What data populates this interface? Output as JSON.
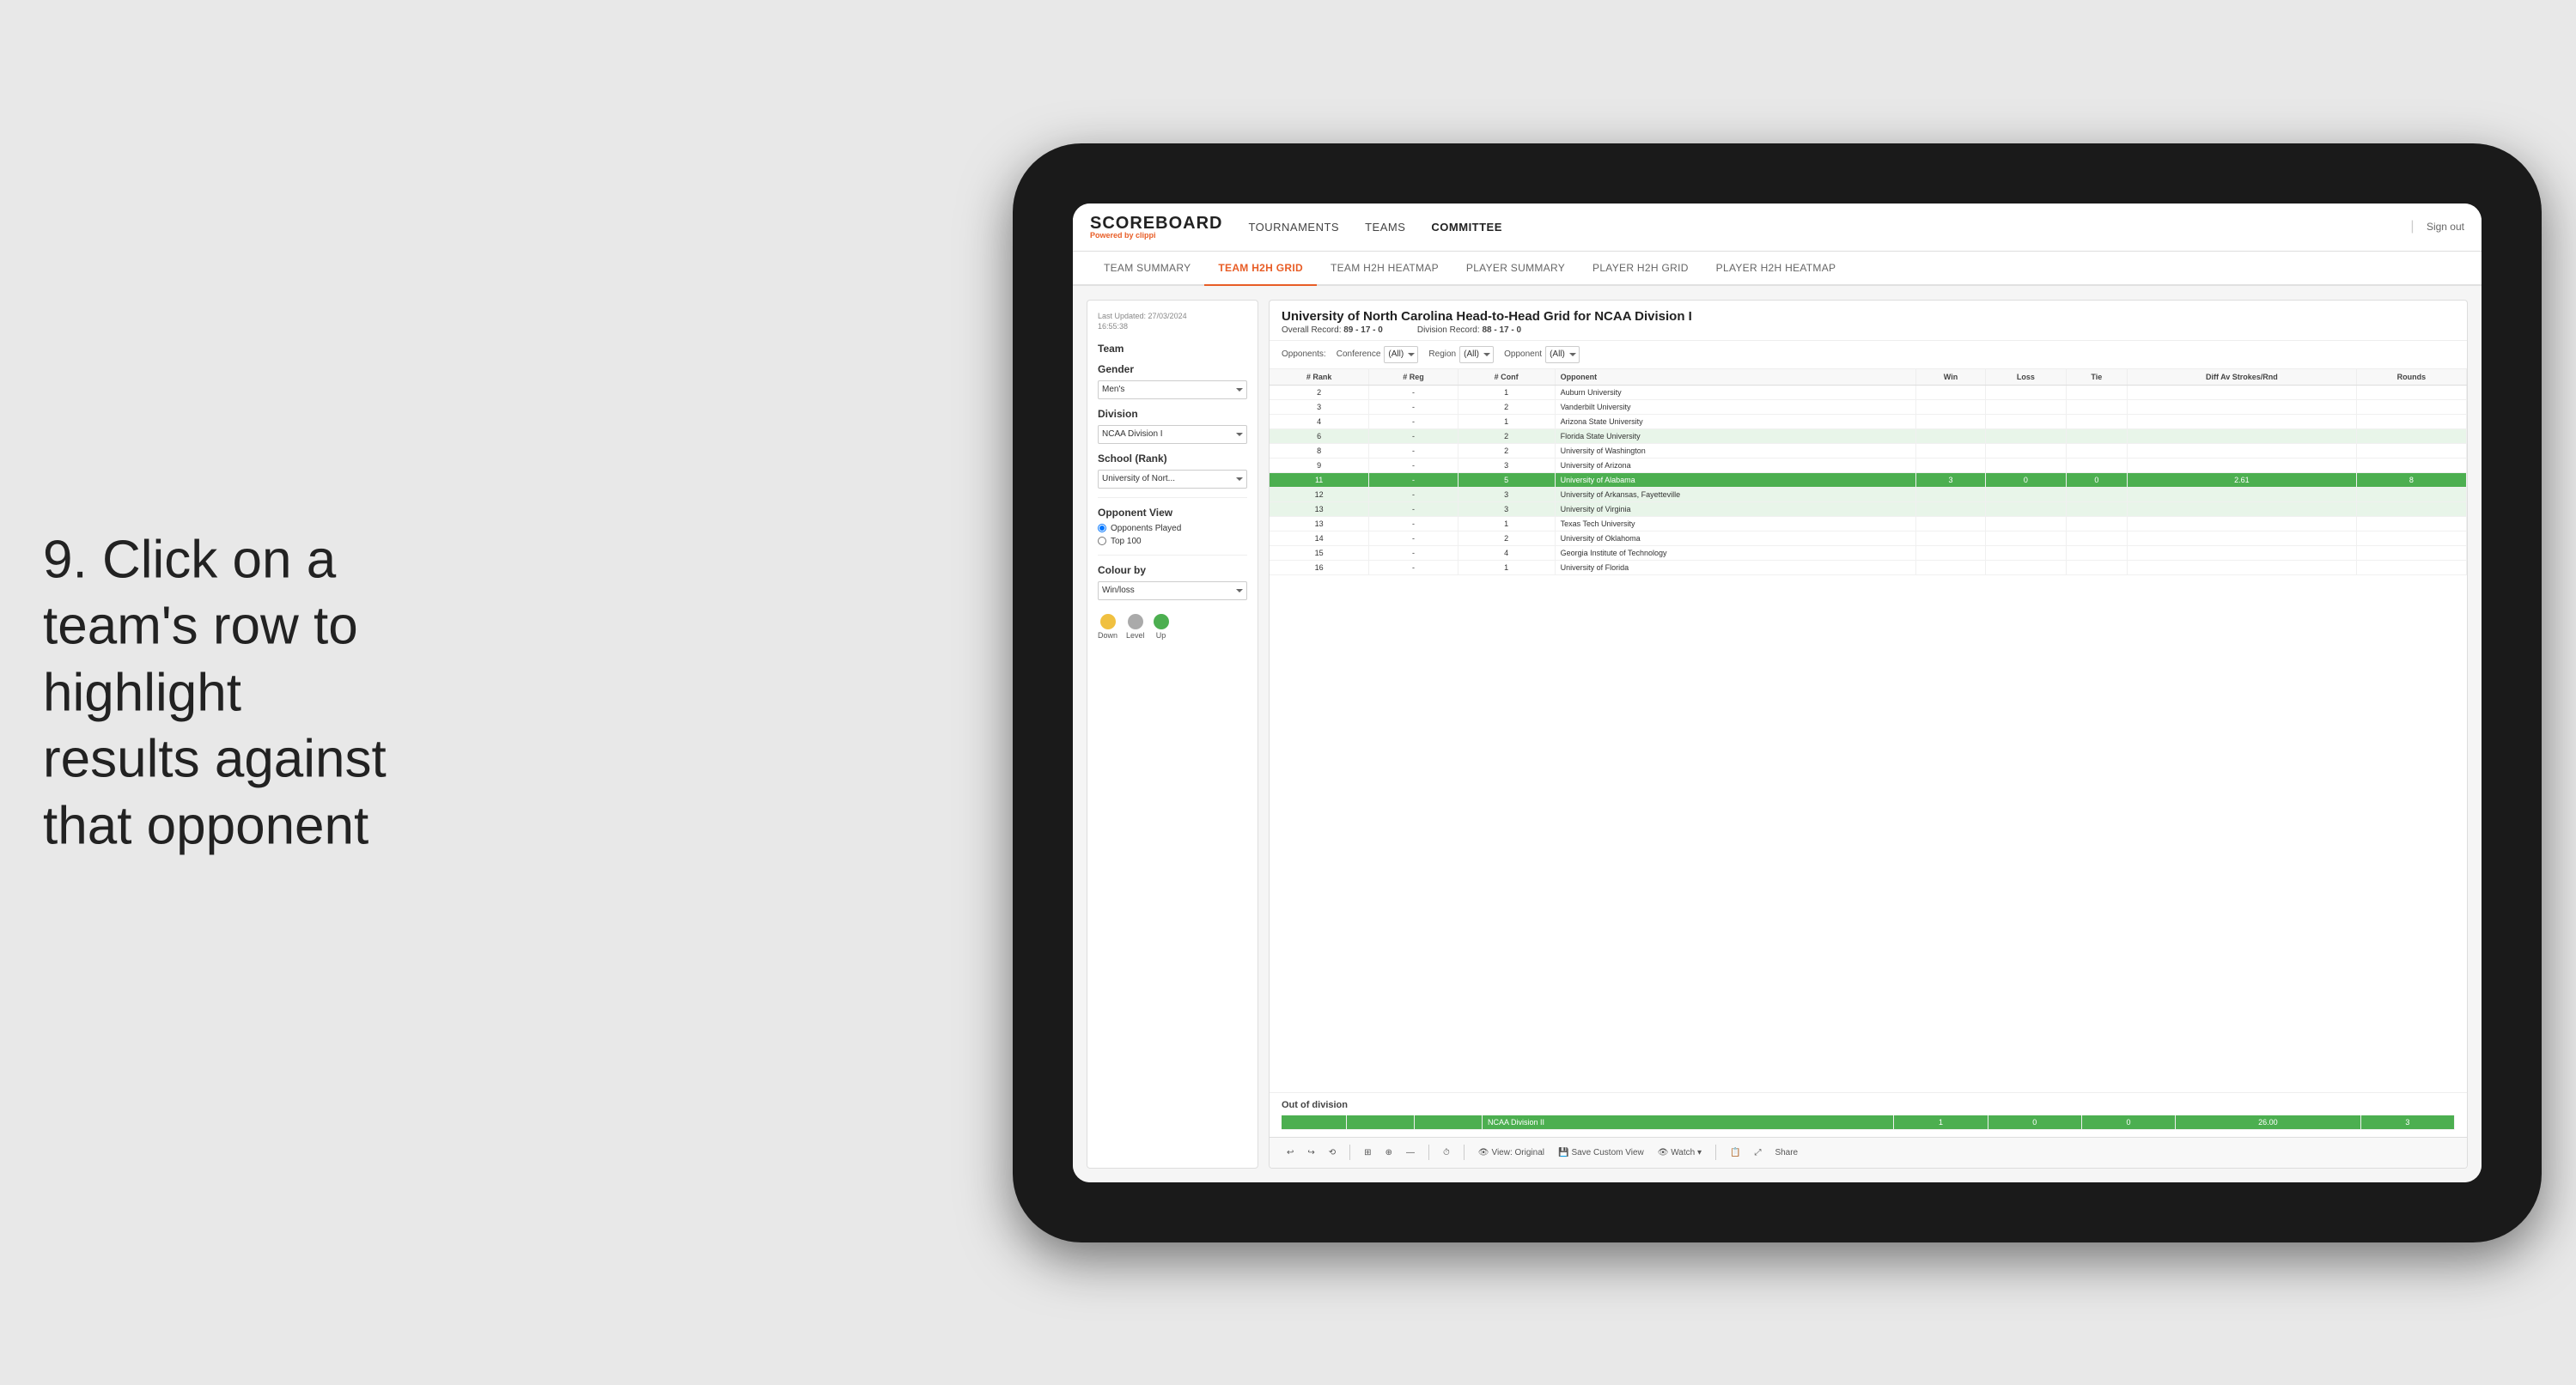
{
  "instruction": {
    "number": "9.",
    "text": "Click on a team's row to highlight results against that opponent"
  },
  "nav": {
    "logo_title": "SCOREBOARD",
    "logo_sub_prefix": "Powered by ",
    "logo_sub_brand": "clippi",
    "items": [
      {
        "label": "TOURNAMENTS",
        "active": false
      },
      {
        "label": "TEAMS",
        "active": false
      },
      {
        "label": "COMMITTEE",
        "active": true
      }
    ],
    "sign_out": "Sign out"
  },
  "sub_nav": {
    "items": [
      {
        "label": "TEAM SUMMARY",
        "active": false
      },
      {
        "label": "TEAM H2H GRID",
        "active": true
      },
      {
        "label": "TEAM H2H HEATMAP",
        "active": false
      },
      {
        "label": "PLAYER SUMMARY",
        "active": false
      },
      {
        "label": "PLAYER H2H GRID",
        "active": false
      },
      {
        "label": "PLAYER H2H HEATMAP",
        "active": false
      }
    ]
  },
  "left_panel": {
    "last_updated_label": "Last Updated: 27/03/2024",
    "last_updated_time": "16:55:38",
    "team_label": "Team",
    "gender_label": "Gender",
    "gender_value": "Men's",
    "division_label": "Division",
    "division_value": "NCAA Division I",
    "school_label": "School (Rank)",
    "school_value": "University of Nort...",
    "opponent_view_label": "Opponent View",
    "opponents_played_label": "Opponents Played",
    "top_100_label": "Top 100",
    "colour_by_label": "Colour by",
    "colour_by_value": "Win/loss",
    "legend": [
      {
        "color": "#f0c040",
        "label": "Down"
      },
      {
        "color": "#aaaaaa",
        "label": "Level"
      },
      {
        "color": "#4caf50",
        "label": "Up"
      }
    ]
  },
  "grid": {
    "title": "University of North Carolina Head-to-Head Grid for NCAA Division I",
    "overall_record_label": "Overall Record:",
    "overall_record": "89 - 17 - 0",
    "division_record_label": "Division Record:",
    "division_record": "88 - 17 - 0",
    "filters": {
      "opponents_label": "Opponents:",
      "conference_label": "Conference",
      "conference_value": "(All)",
      "region_label": "Region",
      "region_value": "(All)",
      "opponent_label": "Opponent",
      "opponent_value": "(All)"
    },
    "columns": [
      {
        "label": "#\nRank",
        "key": "rank"
      },
      {
        "label": "#\nReg",
        "key": "reg"
      },
      {
        "label": "#\nConf",
        "key": "conf"
      },
      {
        "label": "Opponent",
        "key": "opponent"
      },
      {
        "label": "Win",
        "key": "win"
      },
      {
        "label": "Loss",
        "key": "loss"
      },
      {
        "label": "Tie",
        "key": "tie"
      },
      {
        "label": "Diff Av\nStrokes/Rnd",
        "key": "diff"
      },
      {
        "label": "Rounds",
        "key": "rounds"
      }
    ],
    "rows": [
      {
        "rank": "2",
        "reg": "-",
        "conf": "1",
        "opponent": "Auburn University",
        "win": "",
        "loss": "",
        "tie": "",
        "diff": "",
        "rounds": "",
        "highlight": "none"
      },
      {
        "rank": "3",
        "reg": "-",
        "conf": "2",
        "opponent": "Vanderbilt University",
        "win": "",
        "loss": "",
        "tie": "",
        "diff": "",
        "rounds": "",
        "highlight": "none"
      },
      {
        "rank": "4",
        "reg": "-",
        "conf": "1",
        "opponent": "Arizona State University",
        "win": "",
        "loss": "",
        "tie": "",
        "diff": "",
        "rounds": "",
        "highlight": "none"
      },
      {
        "rank": "6",
        "reg": "-",
        "conf": "2",
        "opponent": "Florida State University",
        "win": "",
        "loss": "",
        "tie": "",
        "diff": "",
        "rounds": "",
        "highlight": "light"
      },
      {
        "rank": "8",
        "reg": "-",
        "conf": "2",
        "opponent": "University of Washington",
        "win": "",
        "loss": "",
        "tie": "",
        "diff": "",
        "rounds": "",
        "highlight": "none"
      },
      {
        "rank": "9",
        "reg": "-",
        "conf": "3",
        "opponent": "University of Arizona",
        "win": "",
        "loss": "",
        "tie": "",
        "diff": "",
        "rounds": "",
        "highlight": "none"
      },
      {
        "rank": "11",
        "reg": "-",
        "conf": "5",
        "opponent": "University of Alabama",
        "win": "3",
        "loss": "0",
        "tie": "0",
        "diff": "2.61",
        "rounds": "8",
        "highlight": "selected"
      },
      {
        "rank": "12",
        "reg": "-",
        "conf": "3",
        "opponent": "University of Arkansas, Fayetteville",
        "win": "",
        "loss": "",
        "tie": "",
        "diff": "",
        "rounds": "",
        "highlight": "light"
      },
      {
        "rank": "13",
        "reg": "-",
        "conf": "3",
        "opponent": "University of Virginia",
        "win": "",
        "loss": "",
        "tie": "",
        "diff": "",
        "rounds": "",
        "highlight": "light"
      },
      {
        "rank": "13",
        "reg": "-",
        "conf": "1",
        "opponent": "Texas Tech University",
        "win": "",
        "loss": "",
        "tie": "",
        "diff": "",
        "rounds": "",
        "highlight": "none"
      },
      {
        "rank": "14",
        "reg": "-",
        "conf": "2",
        "opponent": "University of Oklahoma",
        "win": "",
        "loss": "",
        "tie": "",
        "diff": "",
        "rounds": "",
        "highlight": "none"
      },
      {
        "rank": "15",
        "reg": "-",
        "conf": "4",
        "opponent": "Georgia Institute of Technology",
        "win": "",
        "loss": "",
        "tie": "",
        "diff": "",
        "rounds": "",
        "highlight": "none"
      },
      {
        "rank": "16",
        "reg": "-",
        "conf": "1",
        "opponent": "University of Florida",
        "win": "",
        "loss": "",
        "tie": "",
        "diff": "",
        "rounds": "",
        "highlight": "none"
      }
    ],
    "out_of_division": {
      "title": "Out of division",
      "label": "NCAA Division II",
      "win": "1",
      "loss": "0",
      "tie": "0",
      "diff": "26.00",
      "rounds": "3"
    }
  },
  "toolbar": {
    "buttons": [
      {
        "label": "↩",
        "name": "undo"
      },
      {
        "label": "↪",
        "name": "redo"
      },
      {
        "label": "⟲",
        "name": "refresh"
      },
      {
        "label": "⊞",
        "name": "grid"
      },
      {
        "label": "⊕",
        "name": "add"
      },
      {
        "label": "—",
        "name": "dash"
      },
      {
        "label": "⏱",
        "name": "timer"
      },
      {
        "label": "View: Original",
        "name": "view-original"
      },
      {
        "label": "Save Custom View",
        "name": "save-custom"
      },
      {
        "label": "Watch ▾",
        "name": "watch"
      },
      {
        "label": "📋",
        "name": "clipboard"
      },
      {
        "label": "⤢",
        "name": "expand"
      },
      {
        "label": "Share",
        "name": "share"
      }
    ]
  },
  "colors": {
    "accent": "#e85d26",
    "selected_row": "#4caf50",
    "light_row": "#e8f5e9",
    "nav_active": "#e85d26"
  }
}
